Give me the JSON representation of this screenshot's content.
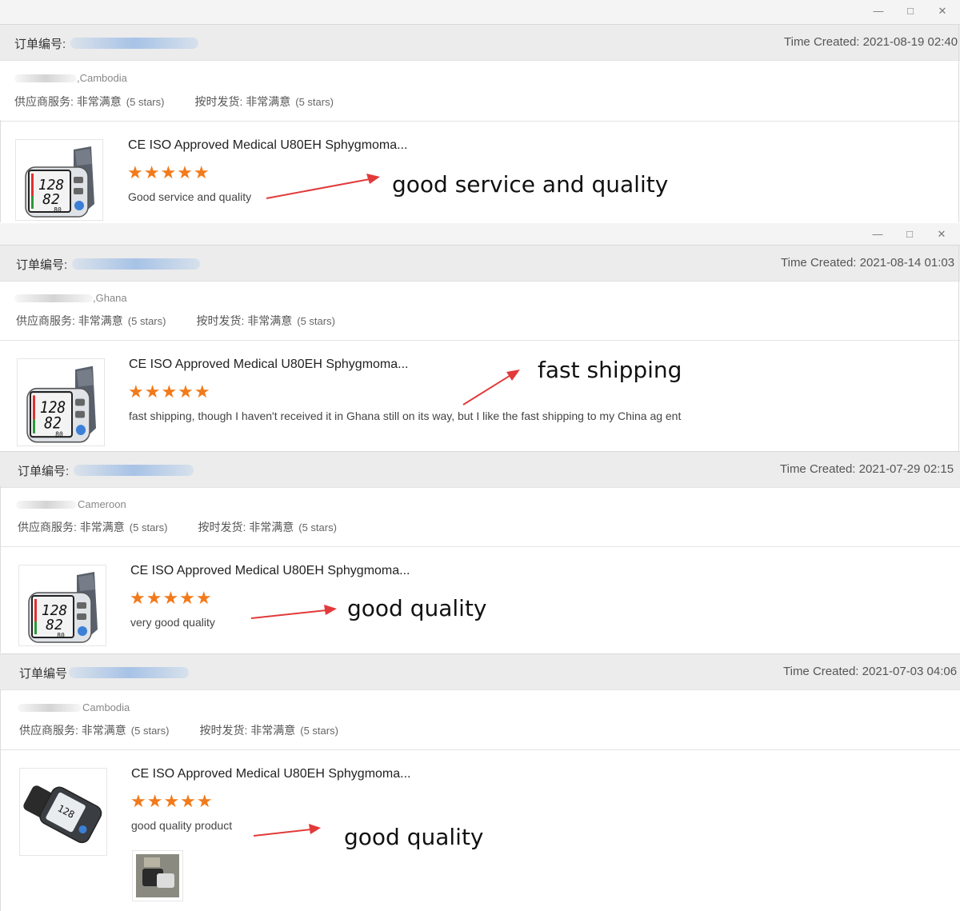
{
  "window": {
    "minimize_glyph": "—",
    "maximize_glyph": "□",
    "close_glyph": "✕"
  },
  "orders": [
    {
      "order_label": "订单编号:",
      "time_created": "Time Created: 2021-08-19 02:40",
      "country": ",Cambodia",
      "supplier_service": "供应商服务: 非常满意",
      "supplier_stars": "(5 stars)",
      "shipping": "按时发货: 非常满意",
      "shipping_stars": "(5 stars)",
      "product": "CE ISO Approved Medical U80EH Sphygmoma...",
      "stars": "★★★★★",
      "review": "Good service and quality",
      "annotation": "good service and quality"
    },
    {
      "order_label": "订单编号:",
      "time_created": "Time Created: 2021-08-14 01:03",
      "country": ",Ghana",
      "supplier_service": "供应商服务: 非常满意",
      "supplier_stars": "(5 stars)",
      "shipping": "按时发货: 非常满意",
      "shipping_stars": "(5 stars)",
      "product": "CE ISO Approved Medical U80EH Sphygmoma...",
      "stars": "★★★★★",
      "review": "fast shipping, though I haven't received it in Ghana still on its way, but I like the fast shipping to my China ag ent",
      "annotation": "fast shipping"
    },
    {
      "order_label": "订单编号:",
      "time_created": "Time Created: 2021-07-29 02:15",
      "country": "Cameroon",
      "supplier_service": "供应商服务: 非常满意",
      "supplier_stars": "(5 stars)",
      "shipping": "按时发货: 非常满意",
      "shipping_stars": "(5 stars)",
      "product": "CE ISO Approved Medical U80EH Sphygmoma...",
      "stars": "★★★★★",
      "review": "very good quality",
      "annotation": "good quality"
    },
    {
      "order_label": "订单编号",
      "time_created": "Time Created: 2021-07-03 04:06",
      "country": "Cambodia",
      "supplier_service": "供应商服务: 非常满意",
      "supplier_stars": "(5 stars)",
      "shipping": "按时发货: 非常满意",
      "shipping_stars": "(5 stars)",
      "product": "CE ISO Approved Medical U80EH Sphygmoma...",
      "stars": "★★★★★",
      "review": "good quality product",
      "annotation": "good quality"
    }
  ],
  "monitor_display": {
    "systolic": "128",
    "diastolic": "82",
    "pulse": "80"
  },
  "colors": {
    "star": "#f27a1a",
    "arrow": "#e23a3a",
    "redaction": "#78aae6"
  }
}
